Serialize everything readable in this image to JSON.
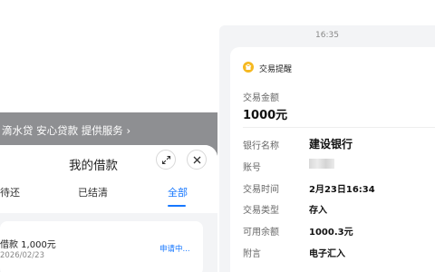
{
  "left_app": {
    "banner_text": "滴水贷 安心贷款 提供服务 ›",
    "sheet_title": "我的借款",
    "tabs": [
      {
        "label": "待还",
        "active": false
      },
      {
        "label": "已结清",
        "active": false
      },
      {
        "label": "全部",
        "active": true
      }
    ],
    "loan": {
      "title": "借款  1,000元",
      "date": "2026/02/23",
      "status": "申请中..."
    },
    "accent_color": "#1677ff"
  },
  "notification": {
    "time": "16:35",
    "title": "交易提醒",
    "amount_label": "交易金额",
    "amount_value": "1000元",
    "rows": [
      {
        "label": "银行名称",
        "value": "建设银行"
      },
      {
        "label": "账号",
        "value": ""
      },
      {
        "label": "交易时间",
        "value": "2月23日16:34"
      },
      {
        "label": "交易类型",
        "value": "存入"
      },
      {
        "label": "可用余额",
        "value": "1000.3元"
      },
      {
        "label": "附言",
        "value": "电子汇入"
      }
    ],
    "icon_color": "#f5b820"
  }
}
